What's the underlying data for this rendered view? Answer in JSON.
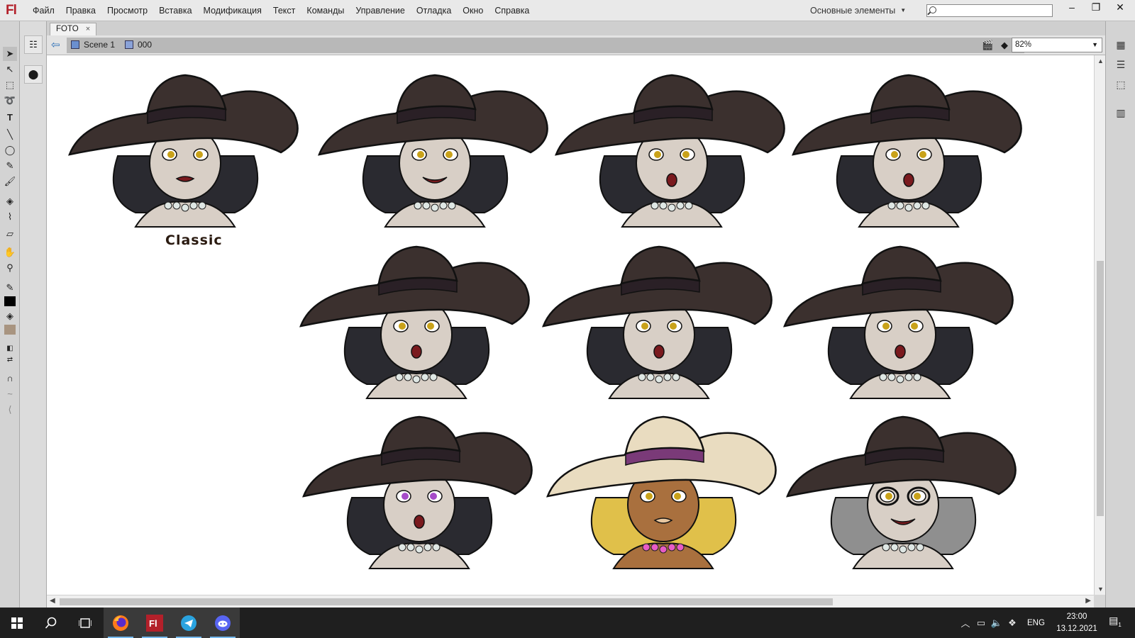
{
  "app": {
    "logo": "Fl",
    "brand_color": "#b3202a"
  },
  "menu": [
    "Файл",
    "Правка",
    "Просмотр",
    "Вставка",
    "Модификация",
    "Текст",
    "Команды",
    "Управление",
    "Отладка",
    "Окно",
    "Справка"
  ],
  "workspace": {
    "label": "Основные элементы"
  },
  "search": {
    "value": "",
    "placeholder": ""
  },
  "window_controls": {
    "minimize": "‒",
    "maximize": "❐",
    "close": "✕"
  },
  "document": {
    "tab_title": "FOTO",
    "tab_close": "×",
    "breadcrumb": [
      {
        "label": "Scene 1",
        "icon": "scene-icon"
      },
      {
        "label": "000",
        "icon": "symbol-icon"
      }
    ],
    "zoom": "82%"
  },
  "stage": {
    "caption": "Classic",
    "portraits": [
      {
        "name": "portrait-classic",
        "hat": "#3b302e",
        "hair": "#2a2a30",
        "skin": "#d8cfc6",
        "mouth": "o"
      },
      {
        "name": "portrait-smile",
        "hat": "#3b302e",
        "hair": "#2a2a30",
        "skin": "#d8cfc6",
        "mouth": "smile"
      },
      {
        "name": "portrait-kiss",
        "hat": "#3b302e",
        "hair": "#2a2a30",
        "skin": "#d8cfc6",
        "mouth": "kiss"
      },
      {
        "name": "portrait-surprised",
        "hat": "#3b302e",
        "hair": "#2a2a30",
        "skin": "#d8cfc6",
        "mouth": "open"
      },
      {
        "name": "portrait-variant-5",
        "hat": "#3b302e",
        "hair": "#2a2a30",
        "skin": "#d8cfc6",
        "mouth": "open"
      },
      {
        "name": "portrait-variant-6",
        "hat": "#3b302e",
        "hair": "#2a2a30",
        "skin": "#d8cfc6",
        "mouth": "open"
      },
      {
        "name": "portrait-variant-7",
        "hat": "#3b302e",
        "hair": "#2a2a30",
        "skin": "#d8cfc6",
        "mouth": "tongue"
      },
      {
        "name": "portrait-hypno",
        "hat": "#3b302e",
        "hair": "#2a2a30",
        "skin": "#d8cfc6",
        "mouth": "open"
      },
      {
        "name": "portrait-blonde",
        "hat": "#e9dcc0",
        "hair": "#e0c04a",
        "skin": "#a9703e",
        "mouth": "lips"
      },
      {
        "name": "portrait-glasses",
        "hat": "#3b302e",
        "hair": "#8f8f8f",
        "skin": "#d8cfc6",
        "mouth": "grin"
      }
    ]
  },
  "taskbar": {
    "apps": [
      "windows-start",
      "search",
      "task-view",
      "firefox",
      "flash",
      "telegram",
      "discord"
    ],
    "language": "ENG",
    "time": "23:00",
    "date": "13.12.2021",
    "notifications": "1"
  }
}
